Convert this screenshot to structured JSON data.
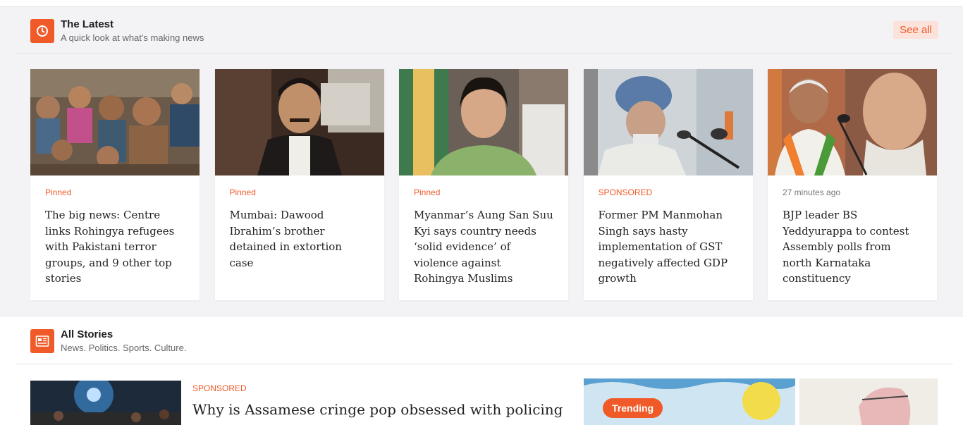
{
  "latest": {
    "title": "The Latest",
    "subtitle": "A quick look at what's making news",
    "see_all": "See all",
    "icon": "clock-icon",
    "accent": "#f05a28",
    "cards": [
      {
        "tag": "Pinned",
        "title": "The big news: Centre links Rohingya refugees with Pakistani terror groups, and 9 other top stories"
      },
      {
        "tag": "Pinned",
        "title": "Mumbai: Dawood Ibrahim’s brother detained in extortion case"
      },
      {
        "tag": "Pinned",
        "title": "Myanmar’s Aung San Suu Kyi says country needs ‘solid evidence’ of violence against Rohingya Muslims"
      },
      {
        "tag": "SPONSORED",
        "title": "Former PM Manmohan Singh says hasty implementation of GST negatively affected GDP growth"
      },
      {
        "tag": "27 minutes ago",
        "title": "BJP leader BS Yeddyurappa to contest Assembly polls from north Karnataka constituency"
      }
    ]
  },
  "all_stories": {
    "title": "All Stories",
    "subtitle": "News. Politics. Sports. Culture.",
    "icon": "newspaper-icon",
    "featured": {
      "tag": "SPONSORED",
      "title": "Why is Assamese cringe pop obsessed with policing"
    },
    "trending_label": "Trending"
  }
}
